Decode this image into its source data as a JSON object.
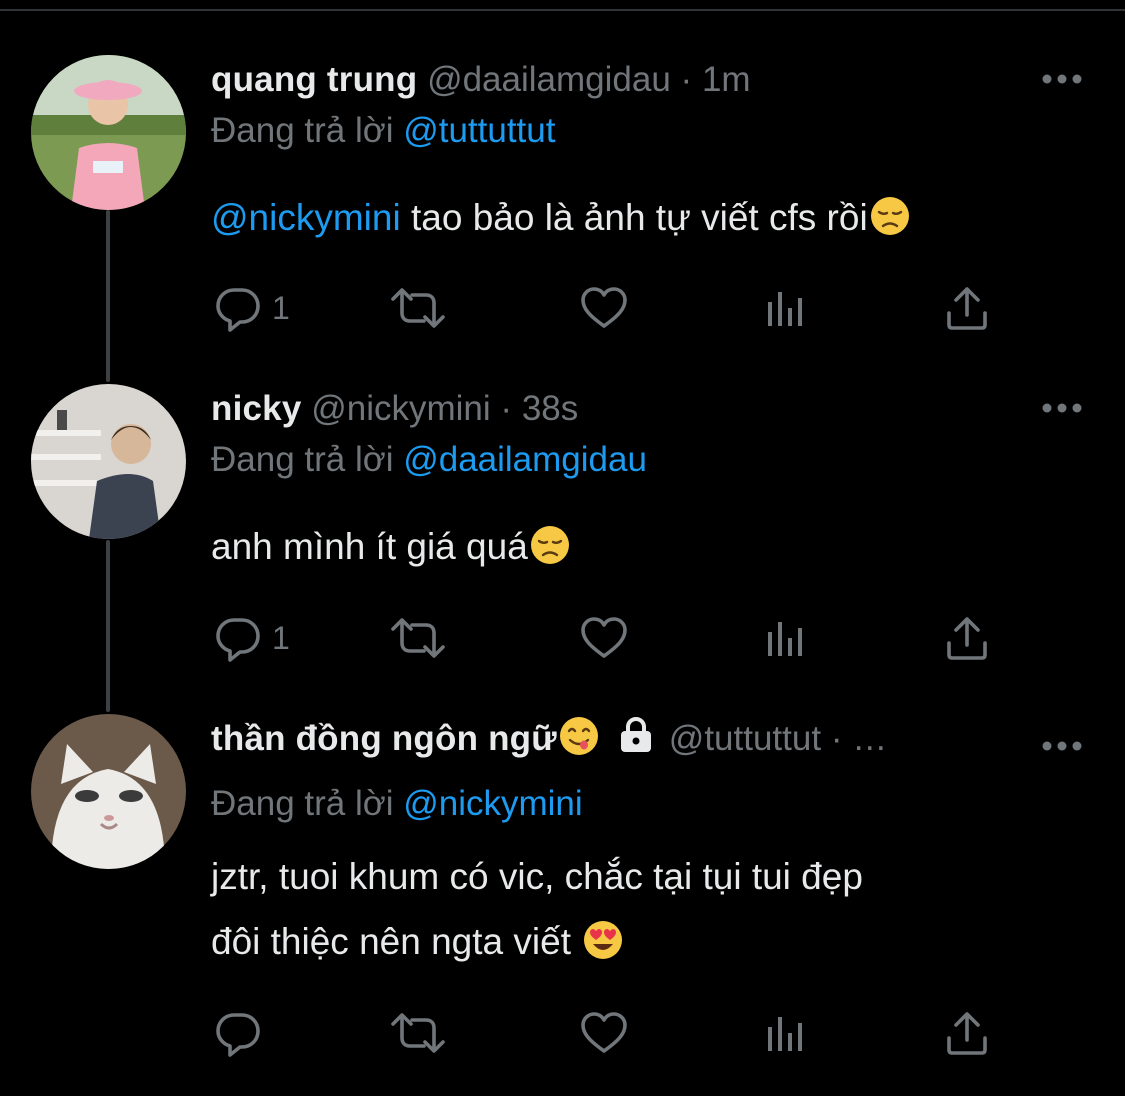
{
  "colors": {
    "background": "#000000",
    "text": "#e7e9ea",
    "muted": "#71767b",
    "link": "#1d9bf0",
    "thread_line": "#3e4144"
  },
  "tweets": [
    {
      "name": "quang trung",
      "handle": "@daailamgidau",
      "separator": "·",
      "time": "1m",
      "replying_prefix": "Đang trả lời",
      "replying_to": "@tuttuttut",
      "text_mention": "@nickymini",
      "text_line1": " tao bảo là ảnh tự viết cfs rồi",
      "text_line2": "",
      "reply_count": "1",
      "avatar_icon": "avatar-person-pink-hat"
    },
    {
      "name": "nicky",
      "handle": "@nickymini",
      "separator": "·",
      "time": "38s",
      "replying_prefix": "Đang trả lời",
      "replying_to": "@daailamgidau",
      "text_mention": "",
      "text_line1": "anh mình ít giá quá",
      "text_line2": "",
      "reply_count": "1",
      "avatar_icon": "avatar-person-jacket"
    },
    {
      "name": "thần đồng ngôn ngữ",
      "handle": "@tuttuttut",
      "separator": "·",
      "time": "…",
      "replying_prefix": "Đang trả lời",
      "replying_to": "@nickymini",
      "text_mention": "",
      "text_line1": "jztr, tuoi khum có vic, chắc tại tụi tui đẹp",
      "text_line2": "đôi thiệc nên ngta viết ",
      "reply_count": "",
      "avatar_icon": "avatar-cat"
    }
  ],
  "icons": [
    "more-icon",
    "reply-icon",
    "retweet-icon",
    "like-icon",
    "analytics-icon",
    "share-icon",
    "lock-icon",
    "disappointed-emoji",
    "yum-emoji",
    "heart-eyes-emoji"
  ]
}
